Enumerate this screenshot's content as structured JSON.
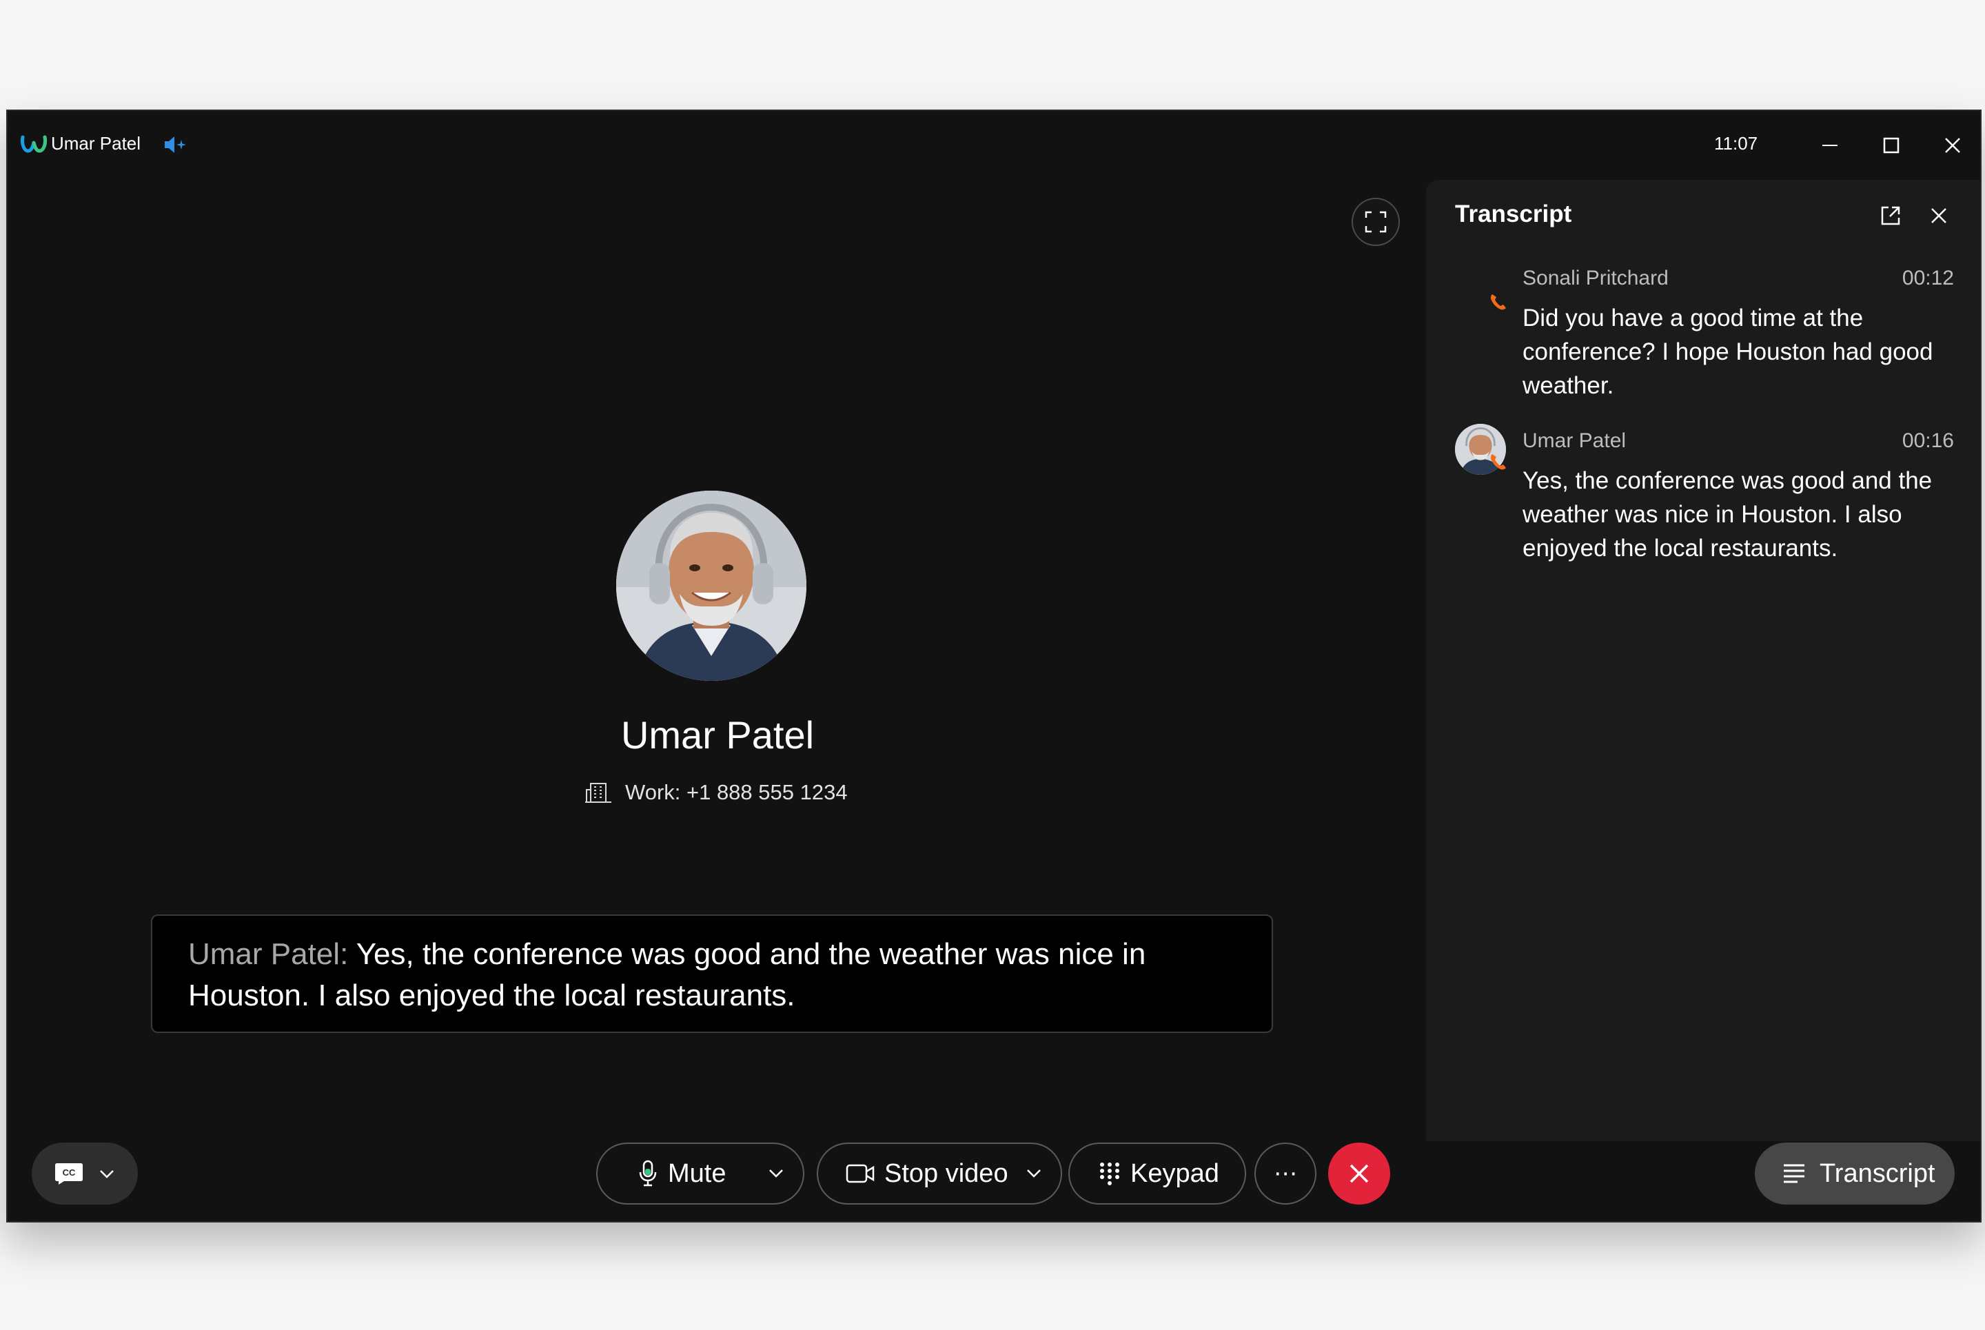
{
  "window": {
    "title": "Umar Patel",
    "clock": "11:07",
    "logo_icon": "webex-logo-icon",
    "audio_icon": "speaker-icon"
  },
  "call": {
    "name": "Umar Patel",
    "number": "Work: +1 888 555 1234",
    "number_icon": "building-icon"
  },
  "caption": {
    "speaker": "Umar Patel:",
    "text": " Yes, the conference was good and the weather was nice in Houston. I also enjoyed the local restaurants."
  },
  "transcript_panel": {
    "title": "Transcript",
    "entries": [
      {
        "speaker": "Sonali Pritchard",
        "time": "00:12",
        "text": "Did you have a good time at the conference? I hope Houston had good weather."
      },
      {
        "speaker": "Umar Patel",
        "time": "00:16",
        "text": "Yes, the conference was good and the weather was nice in Houston. I also enjoyed the local restaurants."
      }
    ]
  },
  "toolbar": {
    "mute_label": "Mute",
    "video_label": "Stop video",
    "keypad_label": "Keypad",
    "more_label": "⋯",
    "transcript_label": "Transcript",
    "cc_label": "CC"
  },
  "colors": {
    "end_call": "#e3233a",
    "phone_accent": "#f26b1d",
    "window_bg": "#121212",
    "panel_bg": "#1b1b1b"
  }
}
